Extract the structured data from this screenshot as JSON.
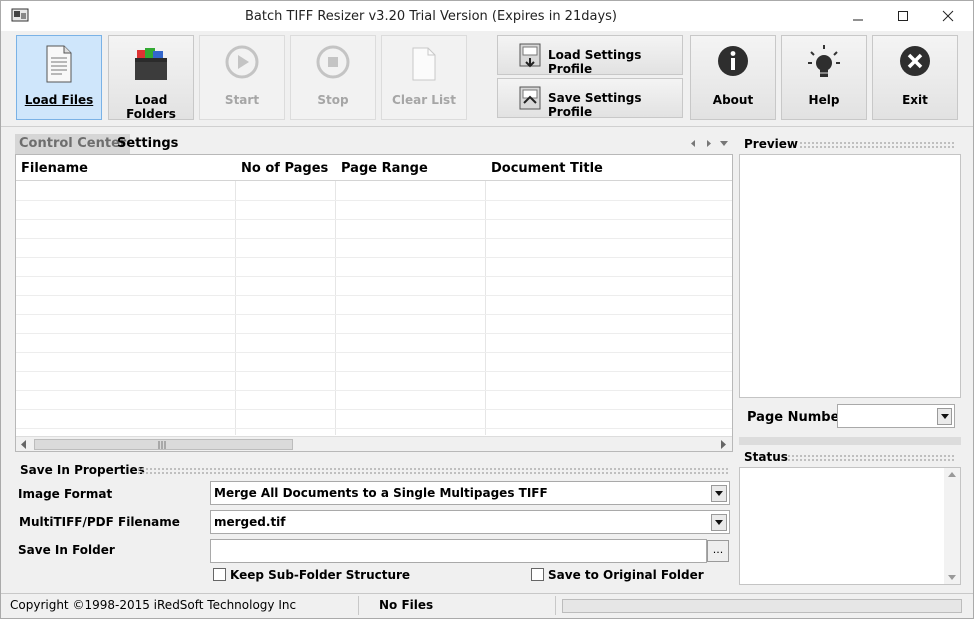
{
  "title_bar": {
    "title": "Batch TIFF Resizer v3.20   Trial Version (Expires in 21days)"
  },
  "toolbar": {
    "load_files": "Load Files",
    "load_folders": "Load Folders",
    "start": "Start",
    "stop": "Stop",
    "clear_list": "Clear List",
    "load_profile": "Load Settings Profile",
    "save_profile": "Save Settings Profile",
    "about": "About",
    "help": "Help",
    "exit": "Exit"
  },
  "tabs": {
    "control_center": "Control Center",
    "settings": "Settings"
  },
  "grid": {
    "columns": [
      "Filename",
      "No of Pages",
      "Page Range",
      "Document Title"
    ],
    "rows": []
  },
  "save_props": {
    "section": "Save In Properties",
    "image_format_label": "Image Format",
    "image_format_value": "Merge All Documents to a Single Multipages TIFF",
    "multitiff_label": "MultiTIFF/PDF Filename",
    "multitiff_value": "merged.tif",
    "save_folder_label": "Save In Folder",
    "save_folder_value": "",
    "browse": "...",
    "keep_structure": "Keep Sub-Folder Structure",
    "save_original": "Save to Original Folder"
  },
  "right": {
    "preview": "Preview",
    "page_number": "Page Number",
    "status": "Status"
  },
  "statusbar": {
    "copyright": "Copyright ©1998-2015 iRedSoft Technology Inc",
    "files": "No Files"
  },
  "colors": {
    "active_button": "#cfe6fb",
    "disabled_text": "#a6a6a6"
  }
}
